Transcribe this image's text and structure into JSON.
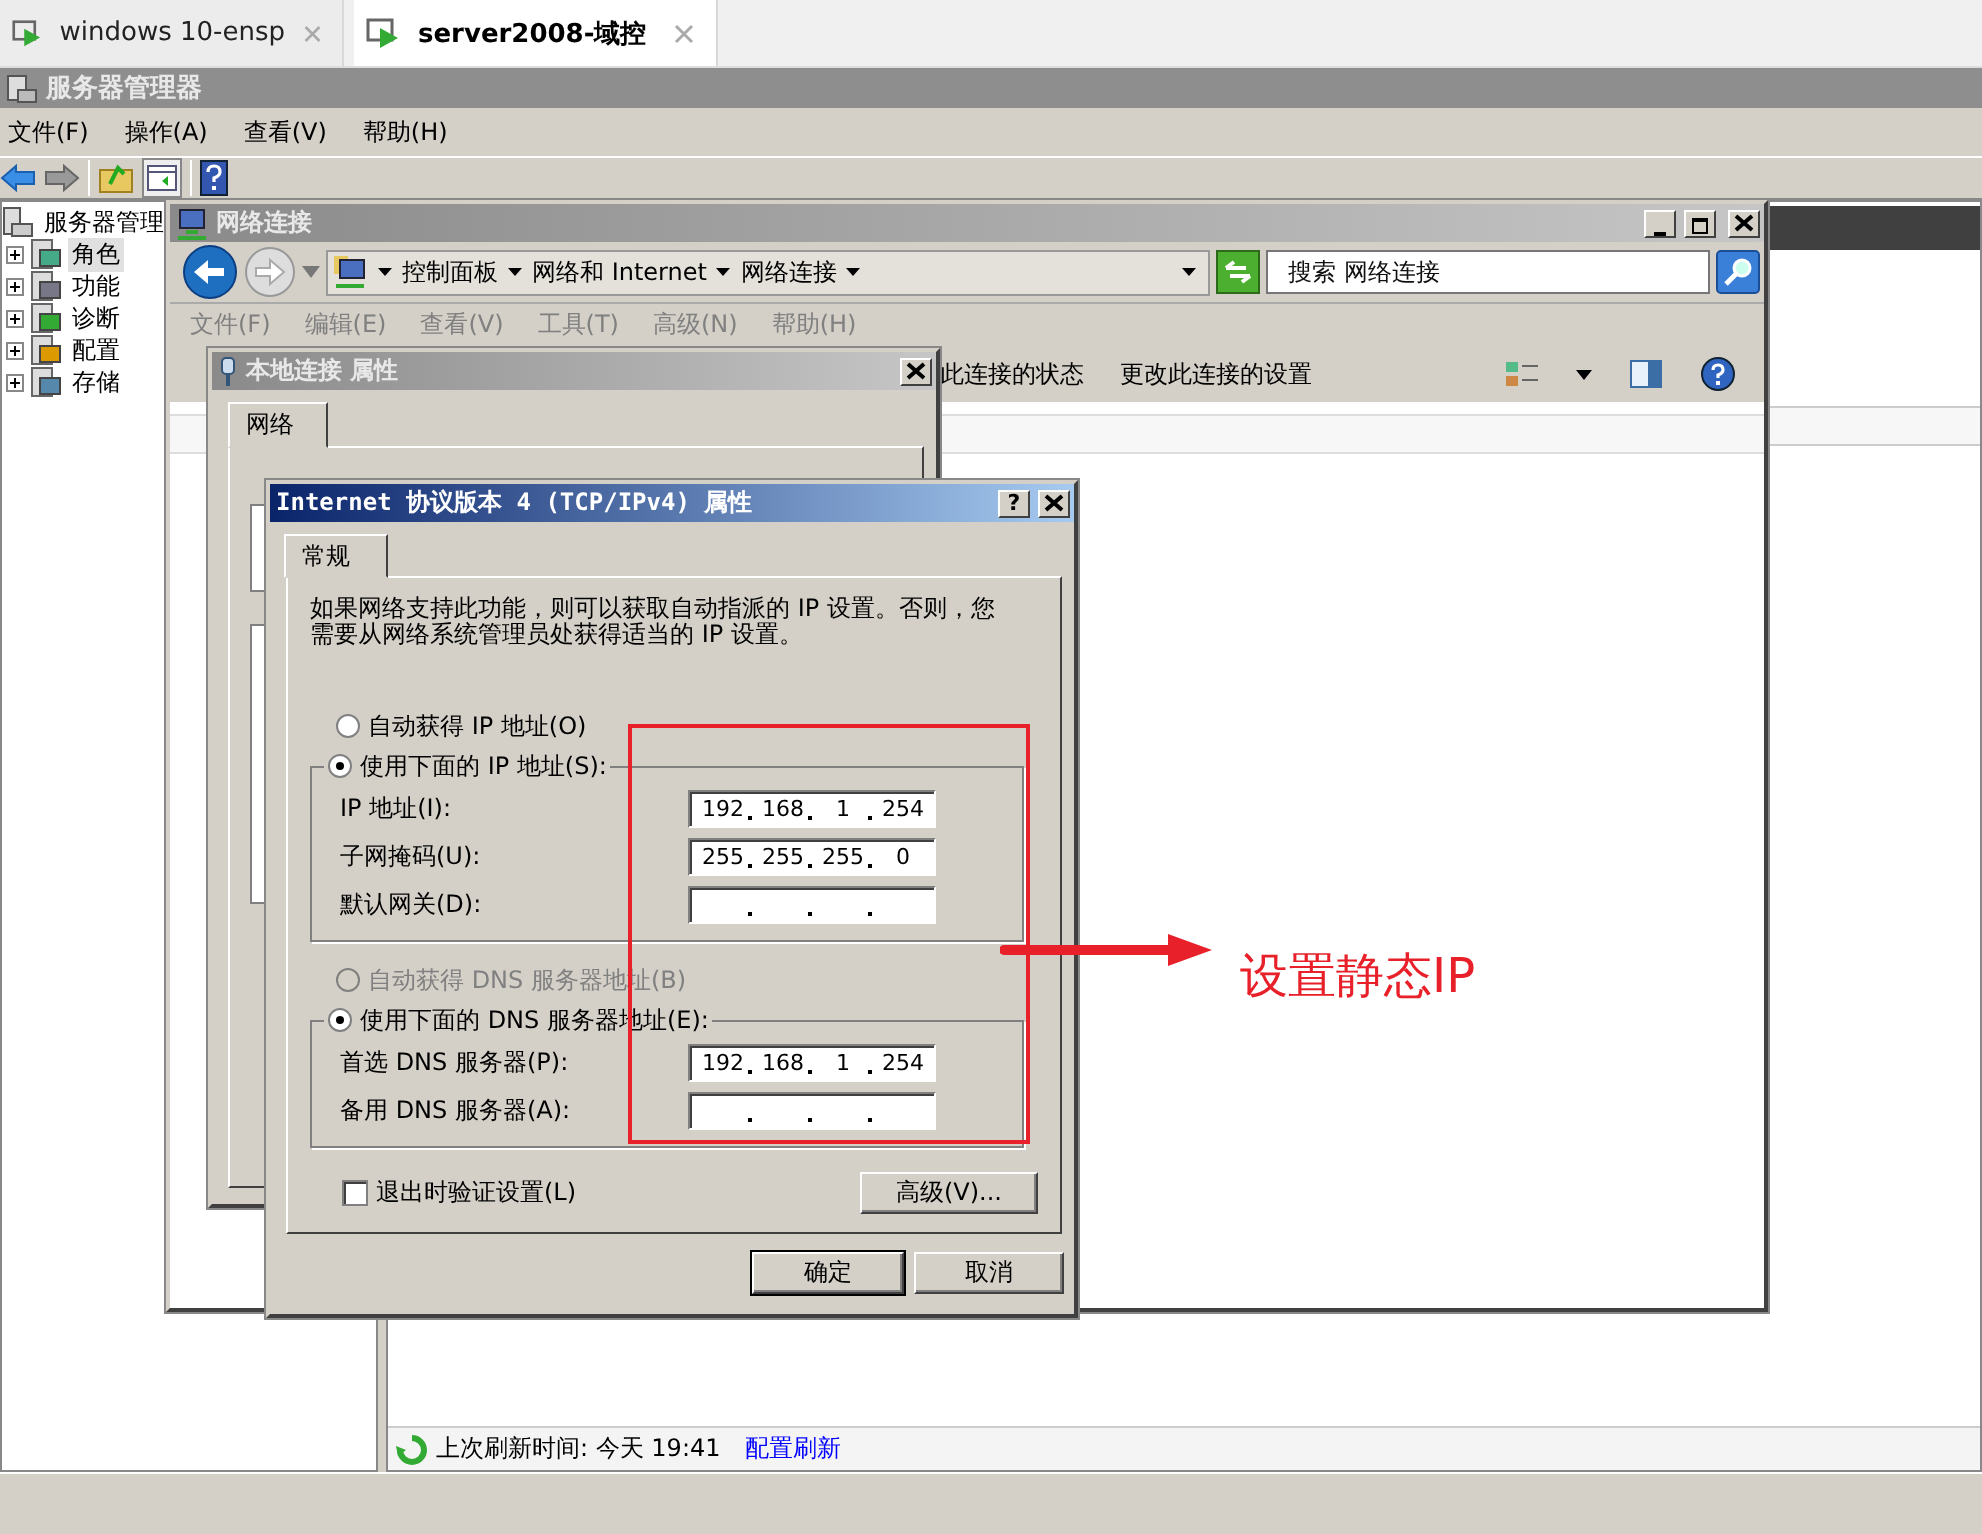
{
  "browser_tabs": [
    {
      "label": "windows 10-ensp",
      "selected": false
    },
    {
      "label": "server2008-域控",
      "selected": true
    }
  ],
  "server_manager": {
    "title": "服务器管理器",
    "menu": [
      "文件(F)",
      "操作(A)",
      "查看(V)",
      "帮助(H)"
    ],
    "tree": {
      "root": "服务器管理",
      "items": [
        {
          "label": "角色",
          "selected": true,
          "expanded": false
        },
        {
          "label": "功能",
          "selected": false,
          "expanded": false
        },
        {
          "label": "诊断",
          "selected": false,
          "expanded": false
        },
        {
          "label": "配置",
          "selected": false,
          "expanded": false
        },
        {
          "label": "存储",
          "selected": false,
          "expanded": false
        }
      ]
    },
    "status": {
      "text": "上次刷新时间: 今天 19:41",
      "link": "配置刷新"
    }
  },
  "network_connections": {
    "title": "网络连接",
    "breadcrumb": [
      "控制面板",
      "网络和 Internet",
      "网络连接"
    ],
    "search": {
      "placeholder": "搜索 网络连接"
    },
    "menu": [
      "文件(F)",
      "编辑(E)",
      "查看(V)",
      "工具(T)",
      "高级(N)",
      "帮助(H)"
    ],
    "commands": [
      "此连接的状态",
      "更改此连接的设置"
    ]
  },
  "local_connection_dialog": {
    "title": "本地连接 属性",
    "tabs": [
      {
        "label": "网络",
        "selected": true
      }
    ]
  },
  "ipv4_dialog": {
    "title": "Internet 协议版本 4 (TCP/IPv4) 属性",
    "help_button": "?",
    "tabs": [
      {
        "label": "常规",
        "selected": true
      }
    ],
    "description": "如果网络支持此功能，则可以获取自动指派的 IP 设置。否则，您需要从网络系统管理员处获得适当的 IP 设置。",
    "ip_mode": [
      {
        "label": "自动获得 IP 地址(O)",
        "selected": false,
        "disabled": false
      },
      {
        "label": "使用下面的 IP 地址(S):",
        "selected": true,
        "disabled": false
      }
    ],
    "ip_fields": [
      {
        "label": "IP 地址(I):",
        "octets": [
          "192",
          "168",
          "1",
          "254"
        ]
      },
      {
        "label": "子网掩码(U):",
        "octets": [
          "255",
          "255",
          "255",
          "0"
        ]
      },
      {
        "label": "默认网关(D):"
      }
    ],
    "dns_mode": [
      {
        "label": "自动获得 DNS 服务器地址(B)",
        "selected": false,
        "disabled": true
      },
      {
        "label": "使用下面的 DNS 服务器地址(E):",
        "selected": true,
        "disabled": false
      }
    ],
    "dns_fields": [
      {
        "label": "首选 DNS 服务器(P):",
        "octets": [
          "192",
          "168",
          "1",
          "254"
        ]
      },
      {
        "label": "备用 DNS 服务器(A):"
      }
    ],
    "validate": {
      "label": "退出时验证设置(L)",
      "checked": false
    },
    "advanced_button": "高级(V)...",
    "buttons": [
      "确定",
      "取消"
    ]
  },
  "annotation": {
    "label": "设置静态IP"
  }
}
